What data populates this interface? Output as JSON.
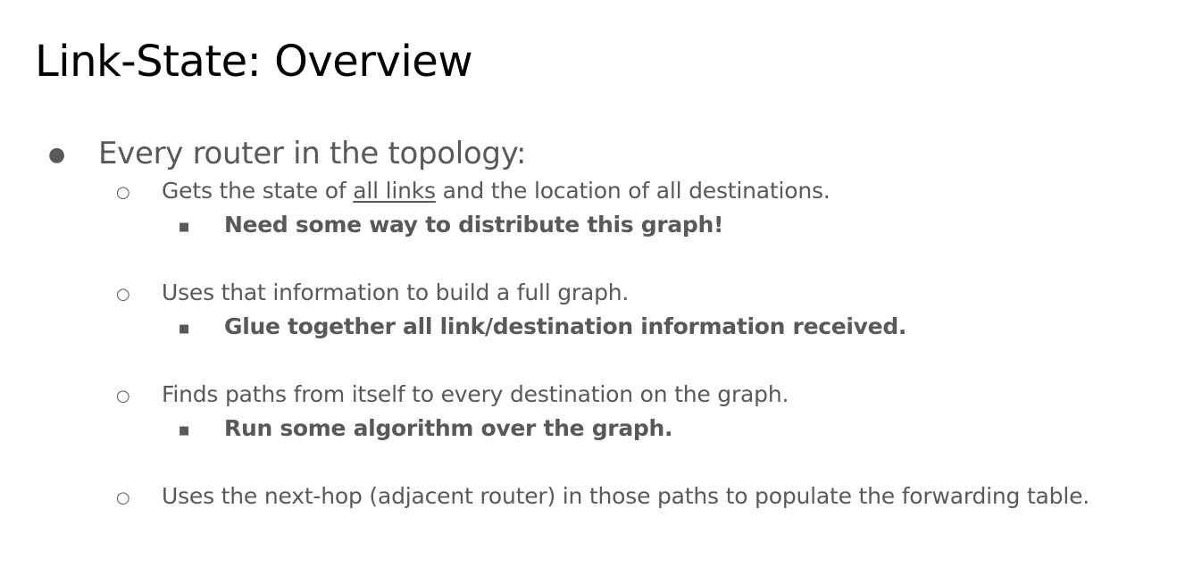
{
  "slide": {
    "title": "Link-State: Overview",
    "bullet": {
      "marker": "●",
      "text": "Every router in the topology:",
      "subitems": [
        {
          "marker": "○",
          "text_before": "Gets the state of ",
          "text_underlined": "all links",
          "text_after": " and the location of all destinations.",
          "detail_marker": "■",
          "detail": "Need some way to distribute this graph!"
        },
        {
          "marker": "○",
          "text": "Uses that information to build a full graph.",
          "detail_marker": "■",
          "detail": "Glue together all link/destination information received."
        },
        {
          "marker": "○",
          "text": "Finds paths from itself to every destination on the graph.",
          "detail_marker": "■",
          "detail": "Run some algorithm over the graph."
        },
        {
          "marker": "○",
          "text": "Uses the next-hop (adjacent router) in those paths to populate the forwarding table."
        }
      ]
    }
  }
}
